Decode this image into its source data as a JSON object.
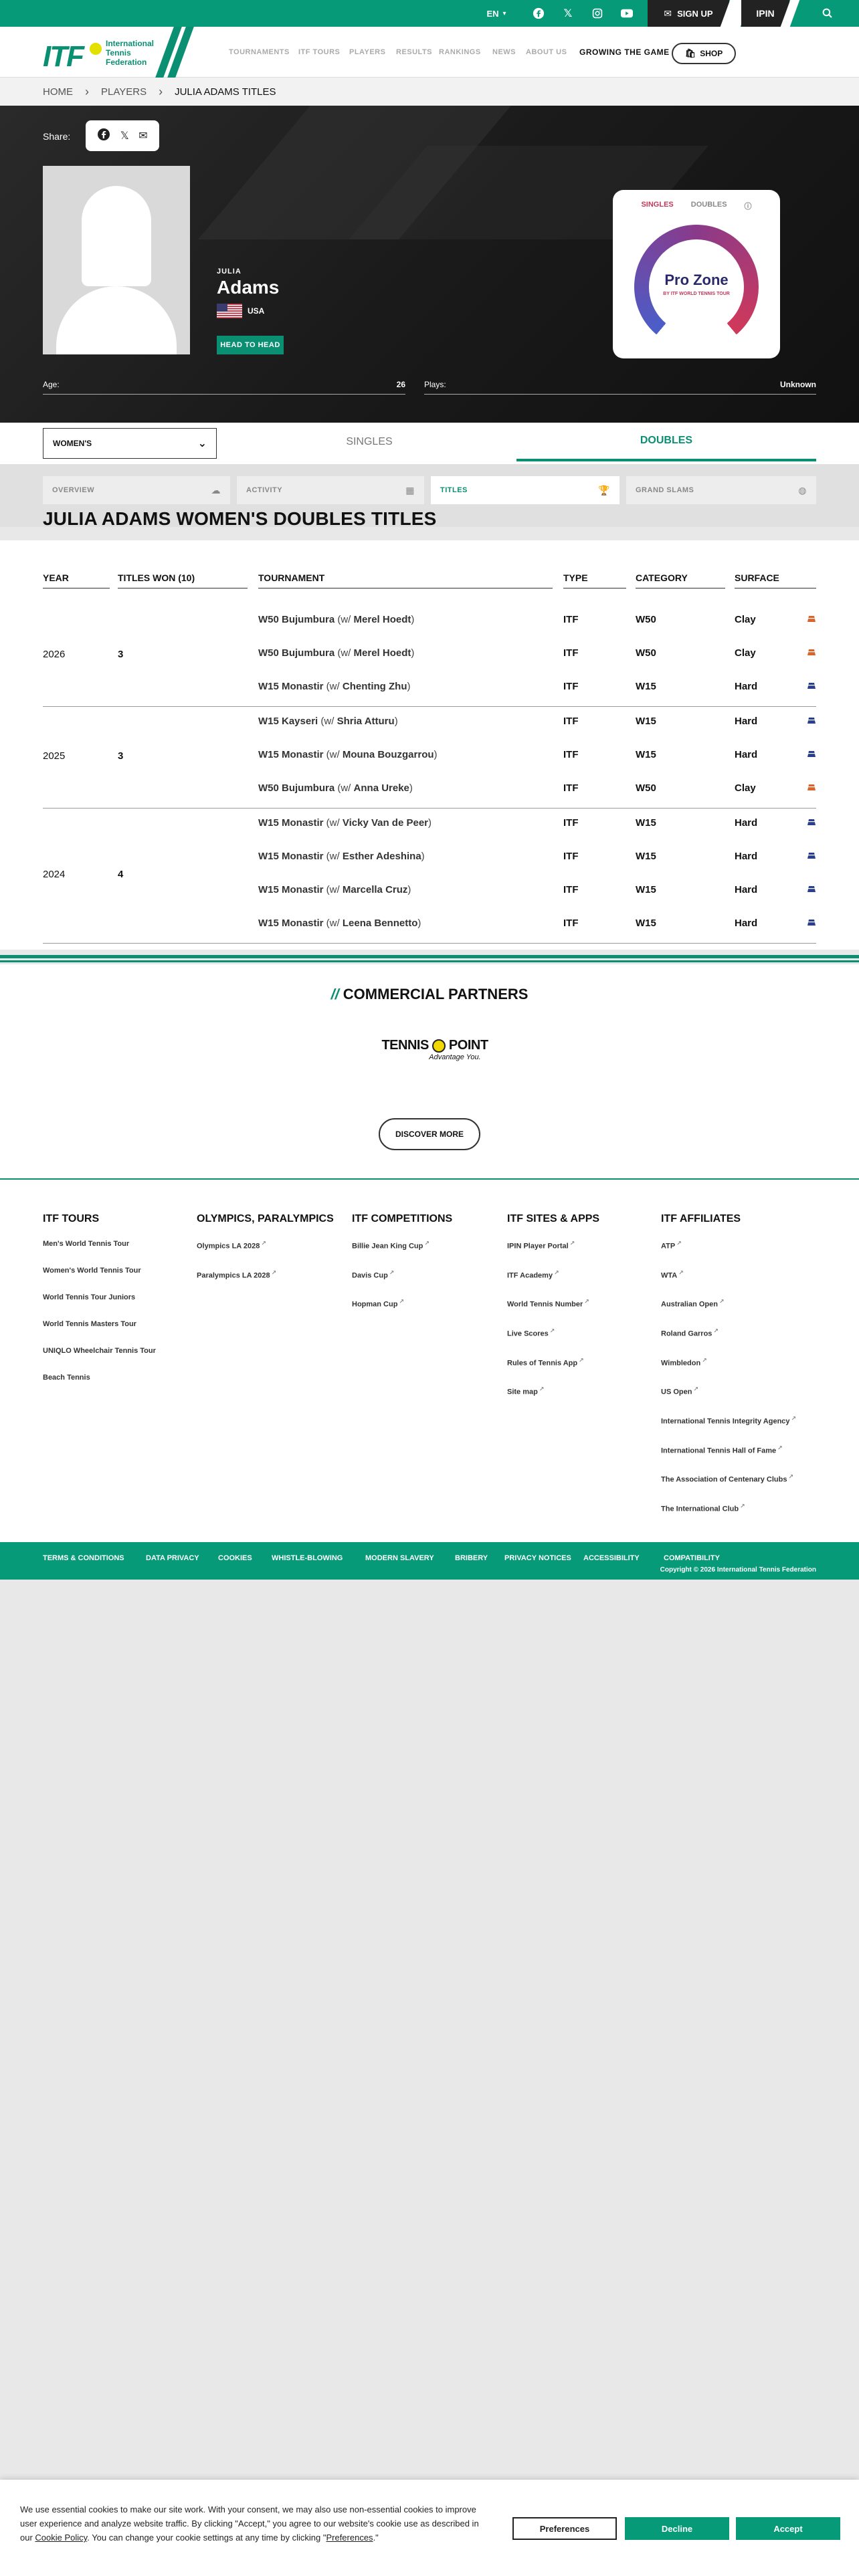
{
  "topbar": {
    "lang": "EN",
    "signup": "SIGN UP",
    "ipin": "IPIN"
  },
  "header": {
    "logo_main": "ITF",
    "logo_text_1": "International",
    "logo_text_2": "Tennis",
    "logo_text_3": "Federation",
    "nav": [
      "TOURNAMENTS",
      "ITF TOURS",
      "PLAYERS",
      "RESULTS",
      "RANKINGS",
      "NEWS",
      "ABOUT US"
    ],
    "growing": "GROWING THE GAME",
    "shop": "SHOP"
  },
  "breadcrumb": {
    "home": "HOME",
    "players": "PLAYERS",
    "current": "JULIA ADAMS TITLES"
  },
  "hero": {
    "share_label": "Share:",
    "first_name": "JULIA",
    "last_name": "Adams",
    "country": "USA",
    "h2h": "HEAD TO HEAD",
    "pro_tab_singles": "SINGLES",
    "pro_tab_doubles": "DOUBLES",
    "pro_zone": "Pro Zone",
    "pro_zone_sub": "BY ITF WORLD TENNIS TOUR",
    "age_label": "Age:",
    "age_value": "26",
    "plays_label": "Plays:",
    "plays_value": "Unknown"
  },
  "selector": {
    "gender": "WOMEN'S",
    "tab_singles": "SINGLES",
    "tab_doubles": "DOUBLES"
  },
  "section_tabs": {
    "overview": "OVERVIEW",
    "activity": "ACTIVITY",
    "titles": "TITLES",
    "grand_slams": "GRAND SLAMS"
  },
  "page_title": "JULIA ADAMS WOMEN'S DOUBLES TITLES",
  "table": {
    "headers": {
      "year": "YEAR",
      "titles_won": "TITLES WON (10)",
      "tournament": "TOURNAMENT",
      "type": "TYPE",
      "category": "CATEGORY",
      "surface": "SURFACE"
    },
    "groups": [
      {
        "year": "2026",
        "count": "3",
        "rows": [
          {
            "name": "W50 Bujumbura",
            "partner_prefix": " (w/ ",
            "partner": "Merel Hoedt",
            "suffix": ")",
            "type": "ITF",
            "category": "W50",
            "surface": "Clay"
          },
          {
            "name": "W50 Bujumbura",
            "partner_prefix": " (w/ ",
            "partner": "Merel Hoedt",
            "suffix": ")",
            "type": "ITF",
            "category": "W50",
            "surface": "Clay"
          },
          {
            "name": "W15 Monastir",
            "partner_prefix": " (w/ ",
            "partner": "Chenting Zhu",
            "suffix": ")",
            "type": "ITF",
            "category": "W15",
            "surface": "Hard"
          }
        ]
      },
      {
        "year": "2025",
        "count": "3",
        "rows": [
          {
            "name": "W15 Kayseri",
            "partner_prefix": " (w/ ",
            "partner": "Shria Atturu",
            "suffix": ")",
            "type": "ITF",
            "category": "W15",
            "surface": "Hard"
          },
          {
            "name": "W15 Monastir",
            "partner_prefix": " (w/ ",
            "partner": "Mouna Bouzgarrou",
            "suffix": ")",
            "type": "ITF",
            "category": "W15",
            "surface": "Hard"
          },
          {
            "name": "W50 Bujumbura",
            "partner_prefix": " (w/ ",
            "partner": "Anna Ureke",
            "suffix": ")",
            "type": "ITF",
            "category": "W50",
            "surface": "Clay"
          }
        ]
      },
      {
        "year": "2024",
        "count": "4",
        "rows": [
          {
            "name": "W15 Monastir",
            "partner_prefix": " (w/ ",
            "partner": "Vicky Van de Peer",
            "suffix": ")",
            "type": "ITF",
            "category": "W15",
            "surface": "Hard"
          },
          {
            "name": "W15 Monastir",
            "partner_prefix": " (w/ ",
            "partner": "Esther Adeshina",
            "suffix": ")",
            "type": "ITF",
            "category": "W15",
            "surface": "Hard"
          },
          {
            "name": "W15 Monastir",
            "partner_prefix": " (w/ ",
            "partner": "Marcella Cruz",
            "suffix": ")",
            "type": "ITF",
            "category": "W15",
            "surface": "Hard"
          },
          {
            "name": "W15 Monastir",
            "partner_prefix": " (w/ ",
            "partner": "Leena Bennetto",
            "suffix": ")",
            "type": "ITF",
            "category": "W15",
            "surface": "Hard"
          }
        ]
      }
    ]
  },
  "partners": {
    "title": "COMMERCIAL PARTNERS",
    "logo_1": "TENNIS",
    "logo_2": "POINT",
    "logo_tag": "Advantage You.",
    "discover": "DISCOVER MORE"
  },
  "footer": {
    "cols": [
      {
        "title": "ITF TOURS",
        "items": [
          "Men's World Tennis Tour",
          "Women's World Tennis Tour",
          "World Tennis Tour Juniors",
          "World Tennis Masters Tour",
          "UNIQLO Wheelchair Tennis Tour",
          "Beach Tennis"
        ]
      },
      {
        "title": "OLYMPICS, PARALYMPICS",
        "items": [
          "Olympics LA 2028",
          "Paralympics LA 2028"
        ]
      },
      {
        "title": "ITF COMPETITIONS",
        "items": [
          "Billie Jean King Cup",
          "Davis Cup",
          "Hopman Cup"
        ]
      },
      {
        "title": "ITF SITES & APPS",
        "items": [
          "IPIN Player Portal",
          "ITF Academy",
          "World Tennis Number",
          "Live Scores",
          "Rules of Tennis App",
          "Site map"
        ]
      },
      {
        "title": "ITF AFFILIATES",
        "items": [
          "ATP",
          "WTA",
          "Australian Open",
          "Roland Garros",
          "Wimbledon",
          "US Open",
          "International Tennis Integrity Agency",
          "International Tennis Hall of Fame",
          "The Association of Centenary Clubs",
          "The International Club"
        ]
      }
    ],
    "external_mark": "↗"
  },
  "bottombar": {
    "links": [
      "TERMS & CONDITIONS",
      "DATA PRIVACY",
      "COOKIES",
      "WHISTLE-BLOWING",
      "MODERN SLAVERY",
      "BRIBERY",
      "PRIVACY NOTICES",
      "ACCESSIBILITY",
      "COMPATIBILITY"
    ],
    "copyright": "Copyright © 2026 International Tennis Federation"
  },
  "cookie": {
    "text_1": "We use essential cookies to make our site work. With your consent, we may also use non-essential cookies to improve user experience and analyze website traffic. By clicking \"Accept,\" you agree to our website's cookie use as described in our ",
    "policy_link": "Cookie Policy",
    "text_2": ". You can change your cookie settings at any time by clicking \"",
    "prefs_link": "Preferences",
    "text_3": ".\"",
    "btn_prefs": "Preferences",
    "btn_decline": "Decline",
    "btn_accept": "Accept"
  },
  "colors": {
    "brand_green": "#069a78",
    "clay": "#d8642a",
    "hard": "#2a3e8f"
  }
}
